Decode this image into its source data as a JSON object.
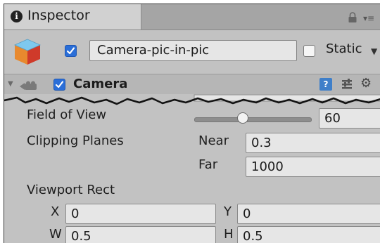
{
  "tab": {
    "title": "Inspector",
    "info_icon": "i"
  },
  "header": {
    "object_active": true,
    "object_name": "Camera-pic-in-pic",
    "static_label": "Static",
    "static_checked": false
  },
  "component": {
    "title": "Camera",
    "enabled": true,
    "help_icon": "?"
  },
  "properties": {
    "field_of_view": {
      "label": "Field of View",
      "value": "60",
      "slider_fraction": 0.42
    },
    "clipping_planes": {
      "label": "Clipping Planes",
      "near_label": "Near",
      "near_value": "0.3",
      "far_label": "Far",
      "far_value": "1000"
    },
    "viewport_rect": {
      "label": "Viewport Rect",
      "x_label": "X",
      "x_value": "0",
      "y_label": "Y",
      "y_value": "0",
      "w_label": "W",
      "w_value": "0.5",
      "h_label": "H",
      "h_value": "0.5"
    }
  },
  "colors": {
    "accent": "#2a6ed8",
    "panel": "#c2c2c2",
    "field": "#e6e6e6"
  }
}
